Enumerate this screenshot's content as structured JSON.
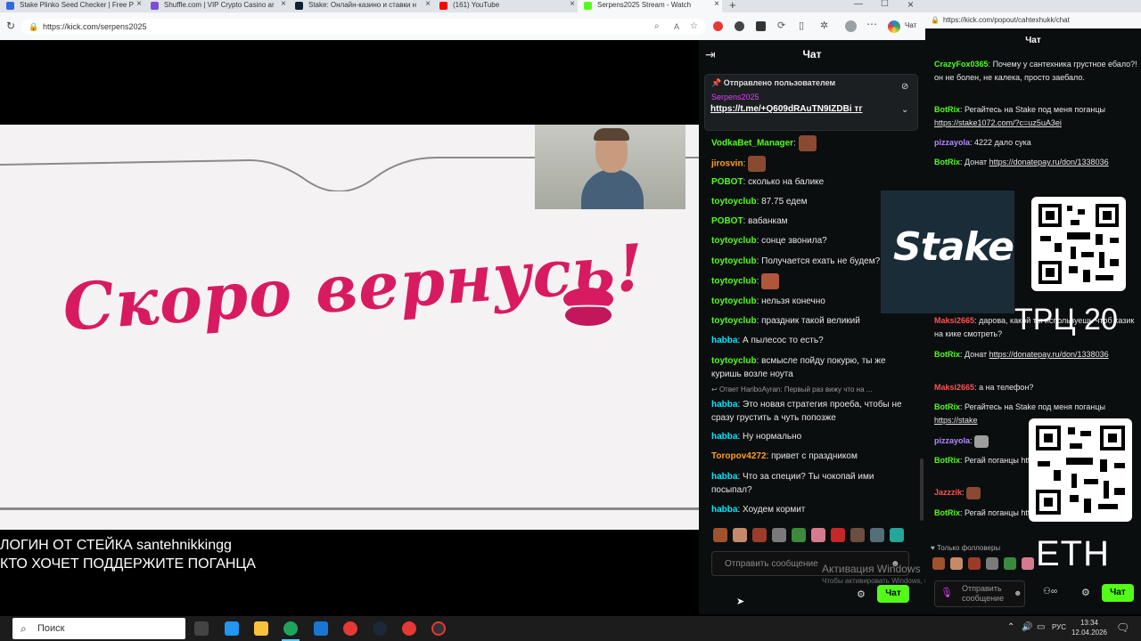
{
  "tabs": [
    {
      "title": "Stake Plinko Seed Checker | Free P",
      "color": "#2f6bde"
    },
    {
      "title": "Shuffle.com | VIP Crypto Casino ar",
      "color": "#7b4dd6"
    },
    {
      "title": "Stake: Онлайн-казино и ставки н",
      "color": "#0f212e"
    },
    {
      "title": "(161) YouTube",
      "color": "#ff0000"
    },
    {
      "title": "Serpens2025 Stream - Watch",
      "color": "#53fc18"
    }
  ],
  "url": "https://kick.com/serpens2025",
  "browser_chat_label": "Чат",
  "stream": {
    "offline_text": "Скоро вернусь!",
    "overlay_line1": "ЛОГИН ОТ СТЕЙКА santehnikkingg",
    "overlay_line2": "КТО ХОЧЕТ ПОДДЕРЖИТЕ ПОГАНЦА"
  },
  "chat": {
    "title": "Чат",
    "pinned_label": "Отправлено пользователем",
    "pinned_user": "Serpens2025",
    "pinned_link": "https://t.me/+Q609dRAuTN9IZDBi",
    "pinned_suffix": "тг",
    "messages": [
      {
        "user": "VodkaBet_Manager",
        "text": "",
        "color": "#53fc18",
        "emote": true
      },
      {
        "user": "jirosvin",
        "text": "",
        "color": "#ff9f1c",
        "emote": true
      },
      {
        "user": "POBOT",
        "text": "сколько на балике",
        "color": "#53fc18"
      },
      {
        "user": "toytoyclub",
        "text": "87.75 едем",
        "color": "#53fc18"
      },
      {
        "user": "POBOT",
        "text": "вабанкам",
        "color": "#53fc18"
      },
      {
        "user": "toytoyclub",
        "text": "сонце звонила?",
        "color": "#53fc18"
      },
      {
        "user": "toytoyclub",
        "text": "Получается ехать не будем?",
        "color": "#53fc18"
      },
      {
        "user": "toytoyclub",
        "text": "",
        "color": "#53fc18",
        "emote": true
      },
      {
        "user": "toytoyclub",
        "text": "нельзя конечно",
        "color": "#53fc18"
      },
      {
        "user": "toytoyclub",
        "text": "праздник такой великий",
        "color": "#53fc18"
      },
      {
        "user": "habba",
        "text": "А пылесос то есть?",
        "color": "#00e5ff"
      },
      {
        "user": "toytoyclub",
        "text": "всмысле пойду покурю, ты же куришь возле ноута",
        "color": "#53fc18"
      },
      {
        "user": "habba",
        "text": "Это новая стратегия проеба, чтобы не сразу грустить а чуть попозже",
        "color": "#00e5ff",
        "reply": "Ответ HariboAyran: Первый раз вижу что на ..."
      },
      {
        "user": "habba",
        "text": "Ну нормально",
        "color": "#00e5ff"
      },
      {
        "user": "Toropov4272",
        "text": "привет с праздником",
        "color": "#ff9f1c"
      },
      {
        "user": "habba",
        "text": "Что за специи? Ты чокопай ими посыпал?",
        "color": "#00e5ff"
      },
      {
        "user": "habba",
        "text": "Хоудем кормит",
        "color": "#00e5ff"
      }
    ],
    "input_placeholder": "Отправить сообщение",
    "send_label": "Чат",
    "activation_line1": "Активация Windows",
    "activation_line2": "Чтобы активировать Windows, перейдите в раздел \"Параметры\"."
  },
  "popout": {
    "url": "https://kick.com/popout/cahtexhukk/chat",
    "title": "Чат",
    "messages": [
      {
        "user": "CrazyFox0365",
        "text": "Почему у сантехника грустное ебало?! он не болен, не калека, просто заебало.",
        "color": "#53fc18"
      },
      {
        "user": "BotRix",
        "text": "Регайтесь на Stake под меня поганцы",
        "link": "https://stake1072.com/?c=uz5uA3ei",
        "color": "#53fc18"
      },
      {
        "user": "pizzayola",
        "text": "4222 дало сука",
        "color": "#b388ff"
      },
      {
        "user": "BotRix",
        "text": "Донат",
        "link": "https://donatepay.ru/don/1338036",
        "color": "#53fc18"
      },
      {
        "user": "Maksi2665",
        "text": "дарова, какой ты используешь чтоб казик на кике смотреть?",
        "color": "#ff5252"
      },
      {
        "user": "BotRix",
        "text": "Донат",
        "link": "https://donatepay.ru/don/1338036",
        "color": "#53fc18"
      },
      {
        "user": "Maksi2665",
        "text": "а на телефон?",
        "color": "#ff5252"
      },
      {
        "user": "BotRix",
        "text": "Регайтесь на Stake под меня поганцы",
        "link": "https://stake",
        "color": "#53fc18"
      },
      {
        "user": "pizzayola",
        "text": "",
        "color": "#b388ff"
      },
      {
        "user": "BotRix",
        "text": "Регай",
        "link": "поганцы https://stake",
        "color": "#53fc18"
      },
      {
        "user": "Jazzzik",
        "text": "",
        "color": "#ff5252"
      },
      {
        "user": "BotRix",
        "text": "Регай",
        "link": "поганцы https://stake",
        "color": "#53fc18"
      }
    ],
    "followers_only": "Только фолловеры",
    "input_placeholder": "Отправить сообщение",
    "send_label": "Чат",
    "stake_logo": "Stake",
    "trc_text": "ТРЦ 20",
    "eth_text": "ETH"
  },
  "taskbar": {
    "search_placeholder": "Поиск",
    "lang": "РУС",
    "time": "13:34",
    "date": "12.04.2026"
  }
}
